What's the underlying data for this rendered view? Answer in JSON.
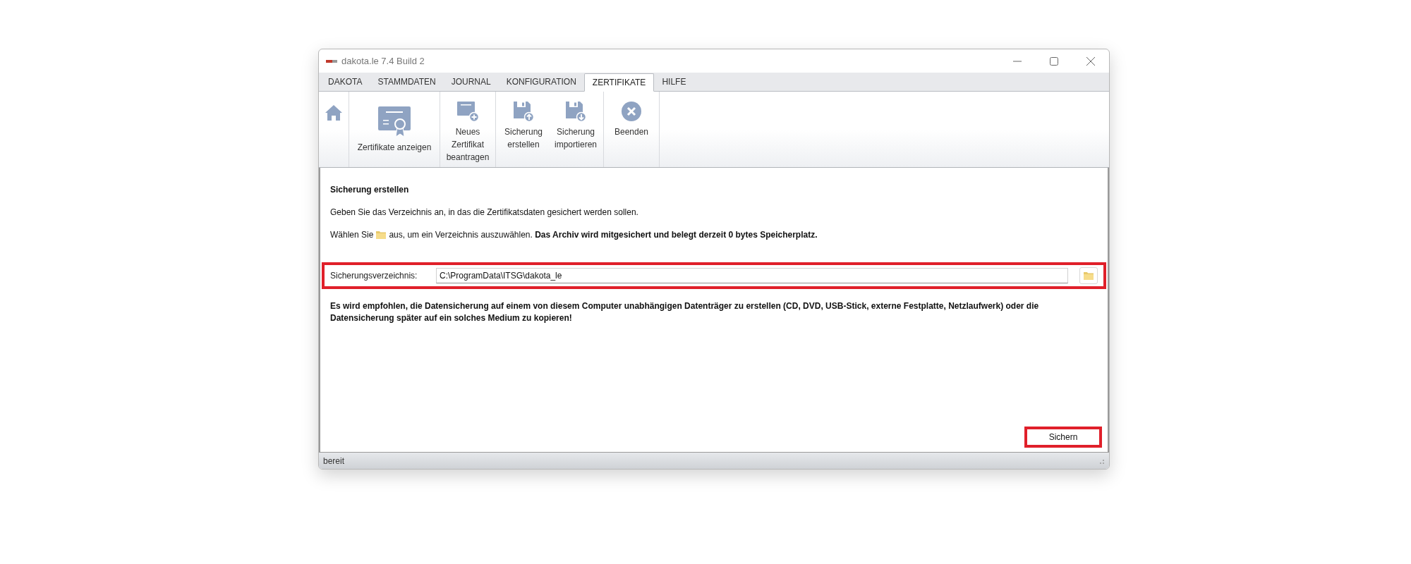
{
  "window": {
    "title": "dakota.le 7.4 Build 2"
  },
  "tabs": [
    {
      "label": "DAKOTA",
      "selected": false
    },
    {
      "label": "STAMMDATEN",
      "selected": false
    },
    {
      "label": "JOURNAL",
      "selected": false
    },
    {
      "label": "KONFIGURATION",
      "selected": false
    },
    {
      "label": "ZERTIFIKATE",
      "selected": true
    },
    {
      "label": "HILFE",
      "selected": false
    }
  ],
  "ribbon": {
    "groups": [
      {
        "buttons": [
          {
            "kind": "home"
          }
        ]
      },
      {
        "buttons": [
          {
            "kind": "certificate",
            "label": "Zertifikate anzeigen"
          }
        ]
      },
      {
        "buttons": [
          {
            "kind": "new-certificate",
            "label": "Neues Zertifikat beantragen"
          }
        ]
      },
      {
        "buttons": [
          {
            "kind": "backup",
            "label": "Sicherung erstellen"
          },
          {
            "kind": "restore",
            "label": "Sicherung importieren"
          }
        ]
      },
      {
        "buttons": [
          {
            "kind": "exit",
            "label": "Beenden"
          }
        ]
      }
    ]
  },
  "content": {
    "heading": "Sicherung erstellen",
    "intro": "Geben Sie das Verzeichnis an, in das die Zertifikatsdaten gesichert werden sollen.",
    "hint_before": "Wählen Sie",
    "hint_after": "aus, um ein Verzeichnis auszuwählen. **Das Archiv wird mitgesichert und belegt derzeit 0 bytes Speicherplatz.**",
    "field": {
      "label": "Sicherungsverzeichnis:",
      "value": "C:\\ProgramData\\ITSG\\dakota_le"
    },
    "warning": "Es wird empfohlen, die Datensicherung auf einem von diesem Computer unabhängigen Datenträger zu erstellen (CD, DVD, USB-Stick, externe Festplatte, Netzlaufwerk) oder die Datensicherung später auf ein solches Medium zu kopieren!",
    "button": "Sichern"
  },
  "status_bar": {
    "text": "bereit"
  }
}
